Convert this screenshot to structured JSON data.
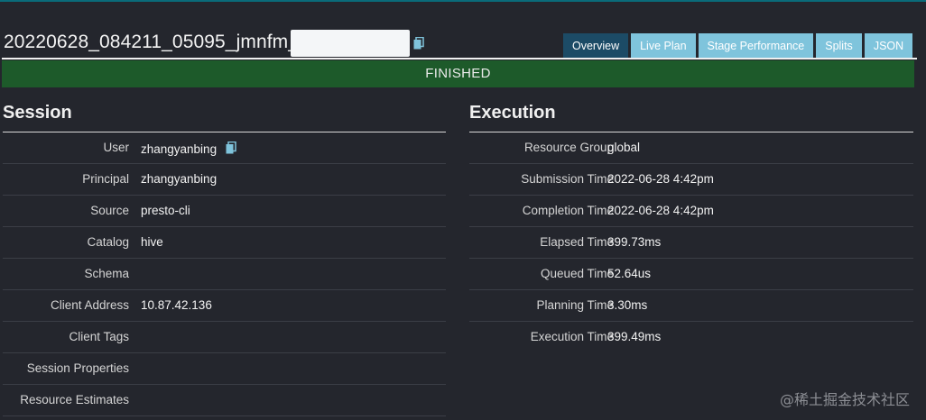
{
  "header": {
    "query_id": "20220628_084211_05095_jmnfm_"
  },
  "tabs": [
    {
      "label": "Overview",
      "active": true
    },
    {
      "label": "Live Plan",
      "active": false
    },
    {
      "label": "Stage Performance",
      "active": false
    },
    {
      "label": "Splits",
      "active": false
    },
    {
      "label": "JSON",
      "active": false
    }
  ],
  "state": "FINISHED",
  "session": {
    "title": "Session",
    "rows": [
      {
        "label": "User",
        "value": "zhangyanbing"
      },
      {
        "label": "Principal",
        "value": "zhangyanbing"
      },
      {
        "label": "Source",
        "value": "presto-cli"
      },
      {
        "label": "Catalog",
        "value": "hive"
      },
      {
        "label": "Schema",
        "value": ""
      },
      {
        "label": "Client Address",
        "value": "10.87.42.136"
      },
      {
        "label": "Client Tags",
        "value": ""
      },
      {
        "label": "Session Properties",
        "value": ""
      },
      {
        "label": "Resource Estimates",
        "value": ""
      }
    ]
  },
  "execution": {
    "title": "Execution",
    "rows": [
      {
        "label": "Resource Group",
        "value": "global"
      },
      {
        "label": "Submission Time",
        "value": "2022-06-28 4:42pm"
      },
      {
        "label": "Completion Time",
        "value": "2022-06-28 4:42pm"
      },
      {
        "label": "Elapsed Time",
        "value": "399.73ms"
      },
      {
        "label": "Queued Time",
        "value": "52.64us"
      },
      {
        "label": "Planning Time",
        "value": "3.30ms"
      },
      {
        "label": "Execution Time",
        "value": "399.49ms"
      }
    ]
  },
  "watermark": "@稀土掘金技术社区",
  "colors": {
    "state_bar": "#1d5a2a",
    "tab_active": "#1c4b66",
    "tab_inactive": "#7fc4dc",
    "background": "#24262d"
  },
  "icons": {
    "copy": "clipboard-copy-icon"
  }
}
